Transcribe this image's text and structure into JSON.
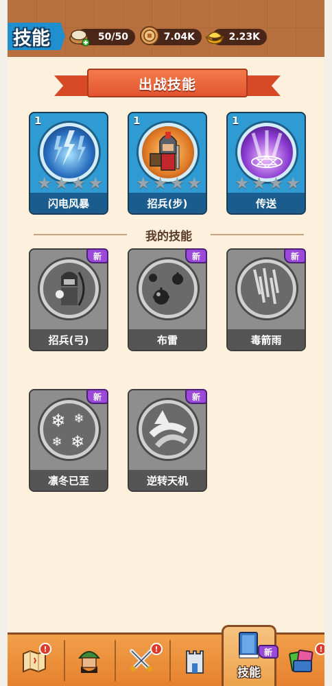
{
  "header": {
    "title": "技能",
    "resources": [
      {
        "icon": "food-bowl-icon",
        "value": "50/50"
      },
      {
        "icon": "coin-icon",
        "value": "7.04K"
      },
      {
        "icon": "gold-ingot-icon",
        "value": "2.23K"
      }
    ]
  },
  "battle_section": {
    "banner": "出战技能",
    "skills": [
      {
        "name": "闪电风暴",
        "level": "1",
        "stars": 4,
        "icon": "lightning-storm-icon"
      },
      {
        "name": "招兵(步)",
        "level": "1",
        "stars": 4,
        "icon": "infantry-soldier-icon"
      },
      {
        "name": "传送",
        "level": "1",
        "stars": 4,
        "icon": "teleport-portal-icon"
      }
    ]
  },
  "my_section": {
    "heading": "我的技能",
    "skills": [
      {
        "name": "招兵(弓)",
        "badge": "新",
        "icon": "archer-soldier-icon"
      },
      {
        "name": "布雷",
        "badge": "新",
        "icon": "mines-icon"
      },
      {
        "name": "毒箭雨",
        "badge": "新",
        "icon": "arrow-rain-icon"
      },
      {
        "name": "凛冬已至",
        "badge": "新",
        "icon": "snowflake-icon"
      },
      {
        "name": "逆转天机",
        "badge": "新",
        "icon": "reversal-icon"
      }
    ]
  },
  "nav": {
    "items": [
      {
        "icon": "map-icon",
        "alert": "!"
      },
      {
        "icon": "hero-icon",
        "alert": ""
      },
      {
        "icon": "crossed-swords-icon",
        "alert": "!"
      },
      {
        "icon": "castle-tower-icon",
        "alert": ""
      },
      {
        "icon": "skill-book-icon",
        "label": "技能",
        "badge": "新"
      },
      {
        "icon": "cards-icon",
        "alert": "!"
      }
    ]
  }
}
